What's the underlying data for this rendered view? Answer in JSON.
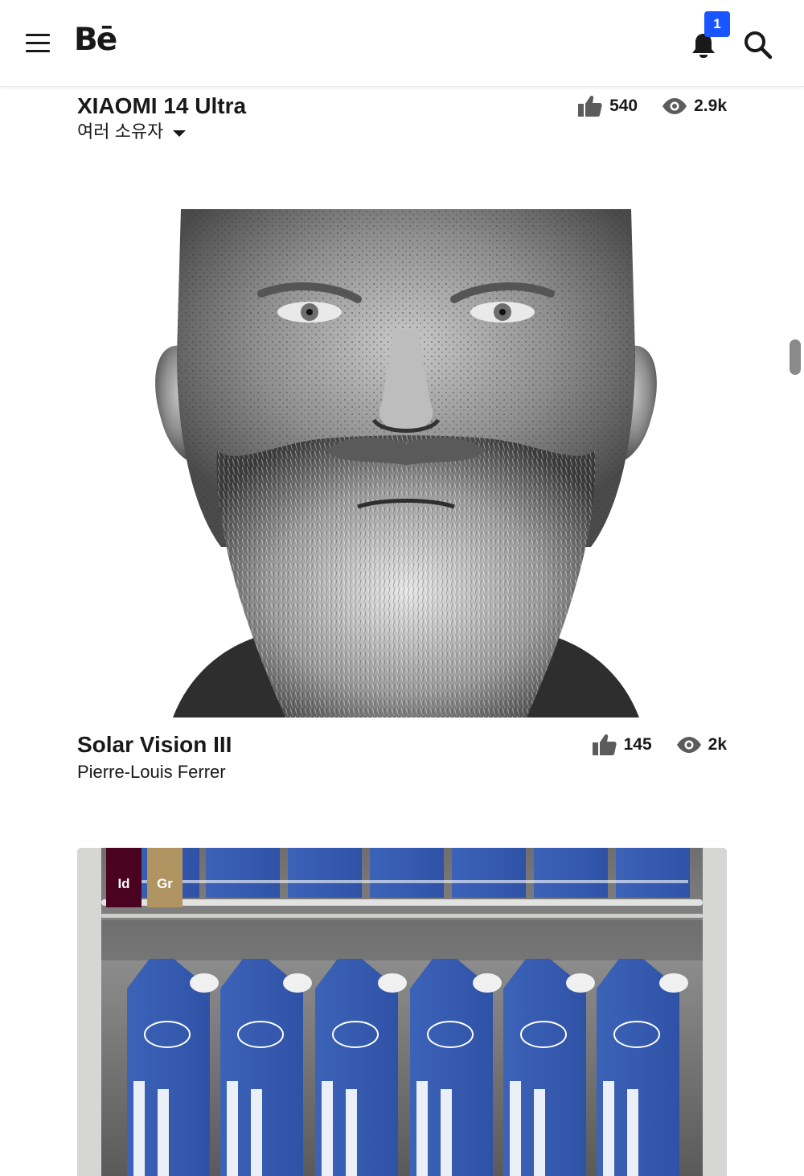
{
  "header": {
    "logo": "Bē",
    "notification_count": "1"
  },
  "projects": [
    {
      "title": "XIAOMI 14 Ultra",
      "owner": "여러 소유자",
      "likes": "540",
      "views": "2.9k"
    },
    {
      "title": "Solar Vision III",
      "owner": "Pierre-Louis Ferrer",
      "likes": "145",
      "views": "2k"
    },
    {
      "tools": [
        "Id",
        "Gr"
      ]
    }
  ],
  "colors": {
    "accent_blue": "#1a56ff",
    "indesign_badge": "#49021f",
    "gr_badge": "#b09563",
    "text": "#191919"
  }
}
